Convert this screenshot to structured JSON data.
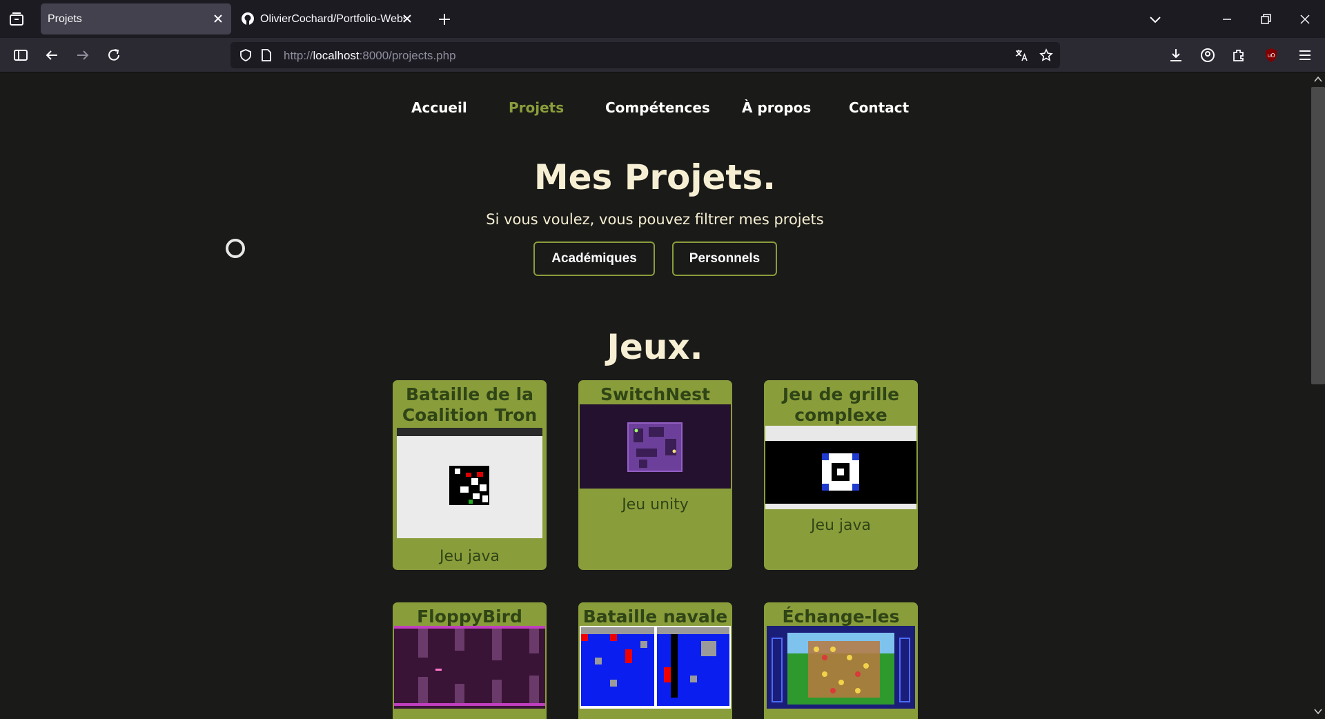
{
  "browser": {
    "tabs": [
      {
        "title": "Projets"
      },
      {
        "title": "OlivierCochard/Portfolio-Websi"
      }
    ],
    "url_scheme": "http://",
    "url_host": "localhost",
    "url_rest": ":8000/projects.php"
  },
  "nav": {
    "items": [
      "Accueil",
      "Projets",
      "Compétences",
      "À propos",
      "Contact"
    ],
    "current": "Projets"
  },
  "header": {
    "title": "Mes Projets.",
    "subtitle": "Si vous voulez, vous pouvez filtrer mes projets",
    "filters": [
      "Académiques",
      "Personnels"
    ]
  },
  "section": {
    "title": "Jeux."
  },
  "projects": [
    {
      "title": "Bataille de la Coalition Tron",
      "description": "Jeu java",
      "thumb_icon": "tron-game-screenshot"
    },
    {
      "title": "SwitchNest",
      "description": "Jeu unity",
      "thumb_icon": "switchnest-screenshot"
    },
    {
      "title": "Jeu de grille complexe",
      "description": "Jeu java",
      "thumb_icon": "grid-game-screenshot"
    },
    {
      "title": "FloppyBird",
      "description": "",
      "thumb_icon": "floppybird-screenshot"
    },
    {
      "title": "Bataille navale",
      "description": "",
      "thumb_icon": "battleship-screenshot"
    },
    {
      "title": "Échange-les tous",
      "description": "",
      "thumb_icon": "match3-screenshot"
    }
  ],
  "colors": {
    "accent": "#8a9d3b",
    "card_text": "#2f4516",
    "heading": "#f6efd3",
    "background": "#1a1a18"
  }
}
